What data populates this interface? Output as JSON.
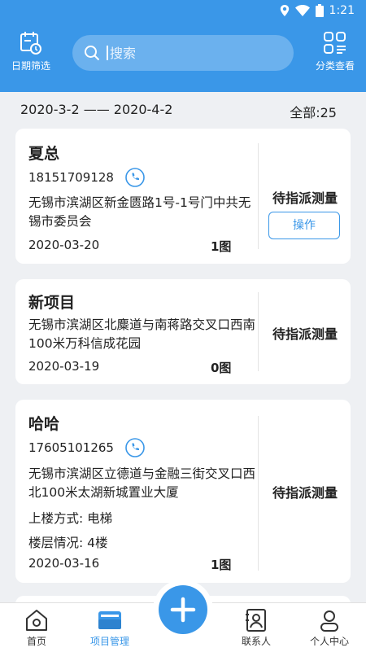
{
  "status_bar": {
    "time": "1:21"
  },
  "header": {
    "date_filter_label": "日期筛选",
    "category_label": "分类查看",
    "search_placeholder": "搜索"
  },
  "summary": {
    "date_range": "2020-3-2 —— 2020-4-2",
    "total": "全部:25"
  },
  "cards": [
    {
      "name": "夏总",
      "phone": "18151709128",
      "address": "无锡市滨湖区新金匮路1号-1号门中共无锡市委员会",
      "date": "2020-03-20",
      "pics": "1图",
      "status": "待指派测量",
      "action": "操作"
    },
    {
      "name": "新项目",
      "address": "无锡市滨湖区北麋道与南蒋路交叉口西南100米万科信成花园",
      "date": "2020-03-19",
      "pics": "0图",
      "status": "待指派测量"
    },
    {
      "name": "哈哈",
      "phone": "17605101265",
      "address": "无锡市滨湖区立德道与金融三街交叉口西北100米太湖新城置业大厦",
      "floor_method": "上楼方式: 电梯",
      "floor_info": "楼层情况: 4楼",
      "date": "2020-03-16",
      "pics": "1图",
      "status": "待指派测量"
    }
  ],
  "tabbar": {
    "home": "首页",
    "projects": "项目管理",
    "contacts": "联系人",
    "profile": "个人中心"
  },
  "colors": {
    "primary": "#3a97e8",
    "background": "#eef0f3"
  }
}
